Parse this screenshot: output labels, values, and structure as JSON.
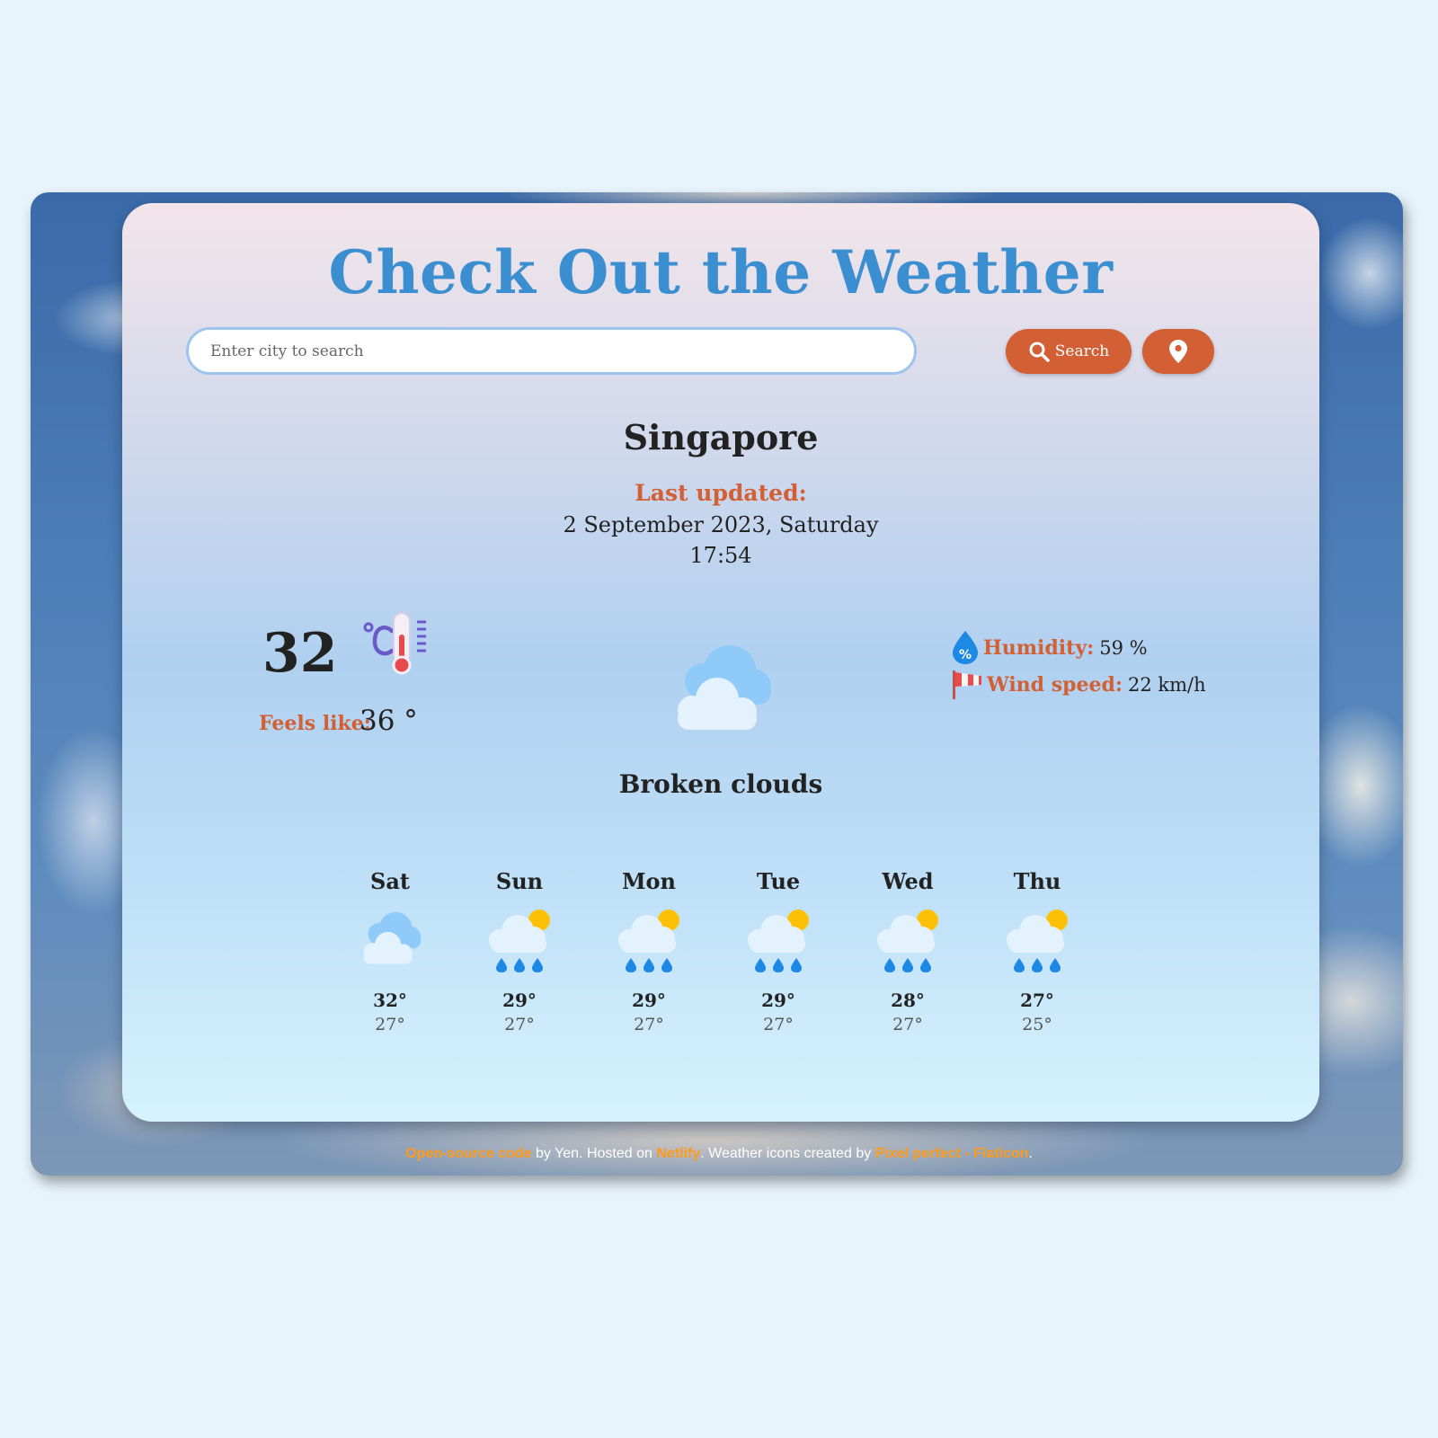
{
  "header": {
    "title": "Check Out the Weather"
  },
  "search": {
    "placeholder": "Enter city to search",
    "value": "",
    "button_label": "Search"
  },
  "location": {
    "city": "Singapore"
  },
  "updated": {
    "label": "Last updated:",
    "date": "2 September 2023, Saturday",
    "time": "17:54"
  },
  "current": {
    "temperature": "32",
    "feels_label": "Feels like:",
    "feels_value": "36 °",
    "condition": "Broken clouds",
    "humidity_label": "Humidity:",
    "humidity_value": "59 %",
    "wind_label": "Wind speed:",
    "wind_value": "22 km/h"
  },
  "forecast": [
    {
      "day": "Sat",
      "hi": "32°",
      "lo": "27°",
      "icon": "broken-clouds-icon"
    },
    {
      "day": "Sun",
      "hi": "29°",
      "lo": "27°",
      "icon": "rain-sun-icon"
    },
    {
      "day": "Mon",
      "hi": "29°",
      "lo": "27°",
      "icon": "rain-sun-icon"
    },
    {
      "day": "Tue",
      "hi": "29°",
      "lo": "27°",
      "icon": "rain-sun-icon"
    },
    {
      "day": "Wed",
      "hi": "28°",
      "lo": "27°",
      "icon": "rain-sun-icon"
    },
    {
      "day": "Thu",
      "hi": "27°",
      "lo": "25°",
      "icon": "rain-sun-icon"
    }
  ],
  "footer": {
    "link_code": "Open-source code",
    "text_by": " by Yen. Hosted on ",
    "link_host": "Netlify",
    "text_icons": ". Weather icons created by ",
    "link_icons": "Pixel perfect - Flaticon",
    "text_end": "."
  },
  "colors": {
    "accent": "#d35f35",
    "title": "#3b8fd0",
    "link": "#ff9b1a"
  }
}
